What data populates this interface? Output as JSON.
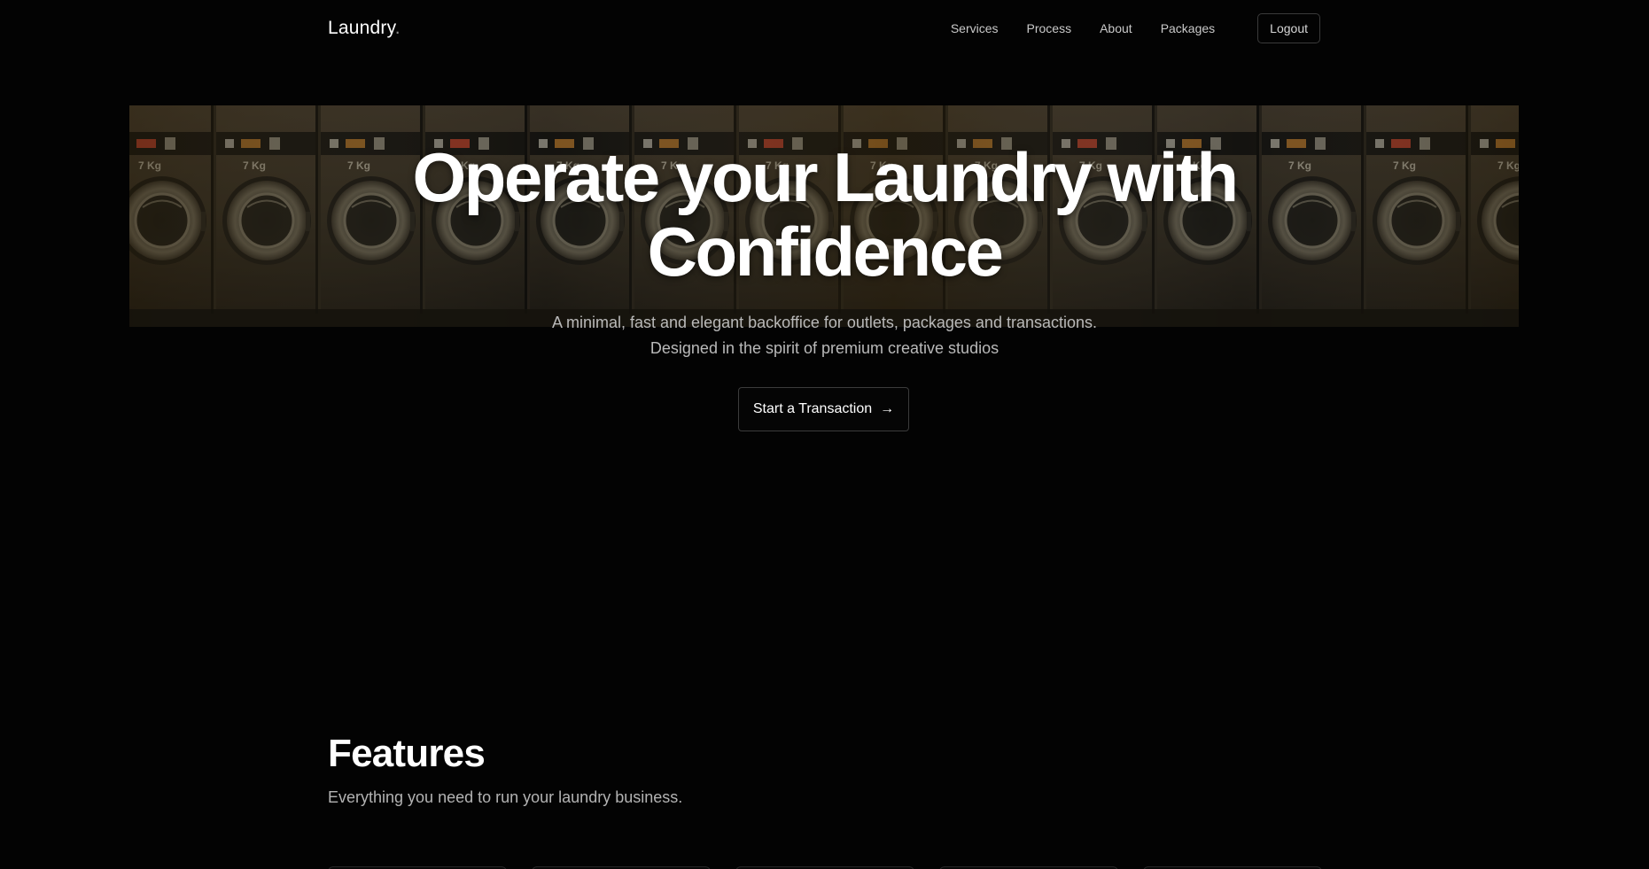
{
  "brand": {
    "name": "Laundry",
    "suffix": "."
  },
  "nav": {
    "links": [
      "Services",
      "Process",
      "About",
      "Packages"
    ],
    "logout_label": "Logout"
  },
  "hero": {
    "title_line1": "Operate your Laundry with",
    "title_line2": "Confidence",
    "subtitle_line1": "A minimal, fast and elegant backoffice for outlets, packages and transactions.",
    "subtitle_line2": "Designed in the spirit of premium creative studios",
    "cta_label": "Start a Transaction",
    "cta_icon": "arrow-right-icon",
    "image_subject": "row of washing machines",
    "machine_label": "7 Kg"
  },
  "features": {
    "title": "Features",
    "subtitle": "Everything you need to run your laundry business."
  },
  "colors": {
    "background": "#030303",
    "text_primary": "#ffffff",
    "text_muted": "#b9b9b9",
    "border": "#3a3a3a"
  }
}
